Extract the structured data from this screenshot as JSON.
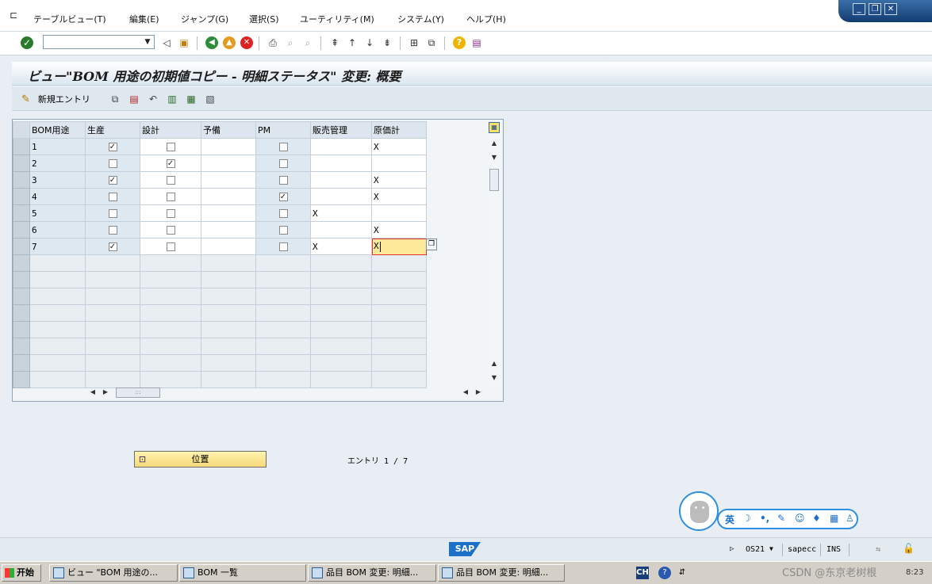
{
  "menu": {
    "items": [
      "テーブルビュー(T)",
      "編集(E)",
      "ジャンプ(G)",
      "選択(S)",
      "ユーティリティ(M)",
      "システム(Y)",
      "ヘルプ(H)"
    ]
  },
  "toolbar": {
    "command_value": ""
  },
  "title": "ビュー\"BOM 用途の初期値コピー - 明細ステータス\" 変更: 概要",
  "app_toolbar": {
    "new_entries_label": "新規エントリ"
  },
  "table": {
    "columns": [
      "BOM用途",
      "生産",
      "設計",
      "予備",
      "PM",
      "販売管理",
      "原価計"
    ],
    "rows": [
      {
        "usage": "1",
        "prod": true,
        "eng": false,
        "spare": "",
        "pm": false,
        "sales": "",
        "cost": "X"
      },
      {
        "usage": "2",
        "prod": false,
        "eng": true,
        "spare": "",
        "pm": false,
        "sales": "",
        "cost": ""
      },
      {
        "usage": "3",
        "prod": true,
        "eng": false,
        "spare": "",
        "pm": false,
        "sales": "",
        "cost": "X"
      },
      {
        "usage": "4",
        "prod": false,
        "eng": false,
        "spare": "",
        "pm": true,
        "sales": "",
        "cost": "X"
      },
      {
        "usage": "5",
        "prod": false,
        "eng": false,
        "spare": "",
        "pm": false,
        "sales": "X",
        "cost": ""
      },
      {
        "usage": "6",
        "prod": false,
        "eng": false,
        "spare": "",
        "pm": false,
        "sales": "",
        "cost": "X"
      },
      {
        "usage": "7",
        "prod": true,
        "eng": false,
        "spare": "",
        "pm": false,
        "sales": "X",
        "cost": "X"
      }
    ],
    "empty_rows": 8
  },
  "position_button": "位置",
  "entry_count": "エントリ 1 / 7",
  "ime": {
    "items": [
      "英",
      "☽",
      "•,",
      "✎",
      "☺",
      "♦",
      "▦",
      "♙"
    ]
  },
  "status": {
    "system": "OS21",
    "server": "sapecc",
    "mode": "INS"
  },
  "taskbar": {
    "start": "开始",
    "tasks": [
      "ビュー \"BOM 用途の...",
      "BOM 一覧",
      "品目 BOM 変更: 明細...",
      "品目 BOM 変更: 明細..."
    ],
    "lang": "CH",
    "clock": "8:23",
    "watermark": "CSDN @东京老树根"
  },
  "colors": {
    "accent": "#2f8fe0",
    "active_cell": "#fde99a",
    "position_button": "#f7d97a"
  }
}
